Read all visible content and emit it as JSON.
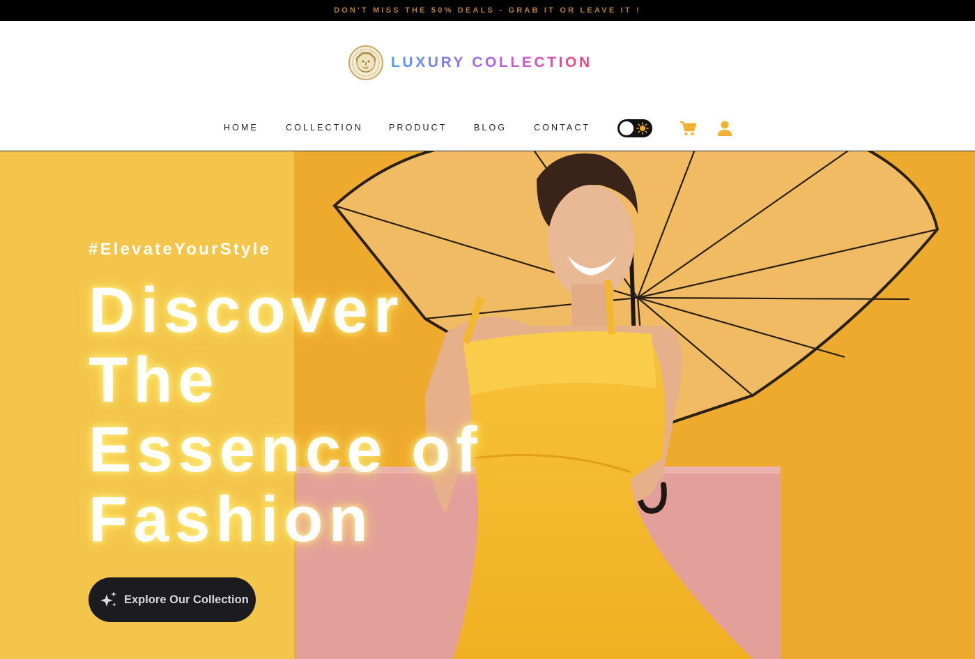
{
  "promo": {
    "text": "DON'T MISS THE 50% DEALS - GRAB IT OR LEAVE IT !"
  },
  "brand": {
    "name": "LUXURY COLLECTION",
    "logo_icon": "medusa-emblem-icon",
    "gradient_colors": [
      "#4b9ef0",
      "#9a6cf2",
      "#d453c8",
      "#f2456b"
    ]
  },
  "nav": {
    "items": [
      {
        "label": "HOME"
      },
      {
        "label": "COLLECTION"
      },
      {
        "label": "PRODUCT"
      },
      {
        "label": "BLOG"
      },
      {
        "label": "CONTACT"
      }
    ],
    "theme_toggle_icon": "sun-icon",
    "cart_icon": "cart-icon",
    "user_icon": "user-icon",
    "accent_color": "#f5b130"
  },
  "hero": {
    "tag": "#ElevateYourStyle",
    "title_lines": [
      "Discover",
      "The",
      "Essence of",
      "Fashion"
    ],
    "cta_label": "Explore Our Collection",
    "cta_icon": "sparkles-icon",
    "background_color": "#efa92a"
  }
}
